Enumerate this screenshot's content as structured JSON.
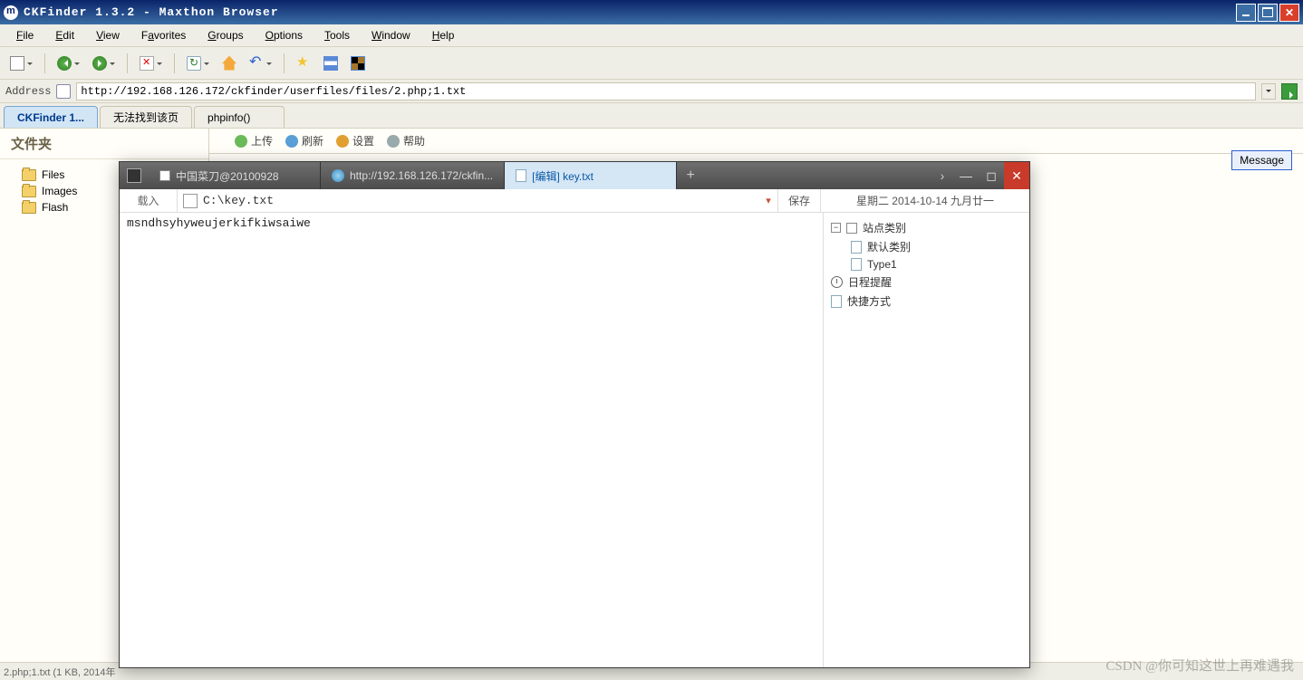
{
  "titlebar": {
    "title": "CKFinder 1.3.2 - Maxthon Browser"
  },
  "menubar": {
    "file": "File",
    "edit": "Edit",
    "view": "View",
    "favorites": "Favorites",
    "groups": "Groups",
    "options": "Options",
    "tools": "Tools",
    "window": "Window",
    "help": "Help"
  },
  "addressbar": {
    "label": "Address",
    "url": "http://192.168.126.172/ckfinder/userfiles/files/2.php;1.txt"
  },
  "browser_tabs": {
    "t0": "CKFinder 1...",
    "t1": "无法找到该页",
    "t2": "phpinfo()"
  },
  "ckfinder": {
    "sidebar_title": "文件夹",
    "folders": {
      "f0": "Files",
      "f1": "Images",
      "f2": "Flash"
    },
    "toolbar": {
      "upload": "上传",
      "refresh": "刷新",
      "settings": "设置",
      "help": "帮助"
    },
    "message_btn": "Message"
  },
  "editor_win": {
    "tabs": {
      "t0": "中国菜刀@20100928",
      "t1": "http://192.168.126.172/ckfin...",
      "t2": "[编辑] key.txt"
    },
    "newtab": "+",
    "pathbar": {
      "load": "载入",
      "path": "C:\\key.txt",
      "save": "保存",
      "date": "星期二 2014-10-14 九月廿一"
    },
    "content": "msndhsyhyweujerkifkiwsaiwe",
    "sidebar": {
      "site_cat": "站点类别",
      "default_cat": "默认类别",
      "type1": "Type1",
      "schedule": "日程提醒",
      "shortcut": "快捷方式"
    }
  },
  "statusbar": {
    "text": "2.php;1.txt (1 KB, 2014年"
  },
  "watermark": "CSDN @你可知这世上再难遇我"
}
